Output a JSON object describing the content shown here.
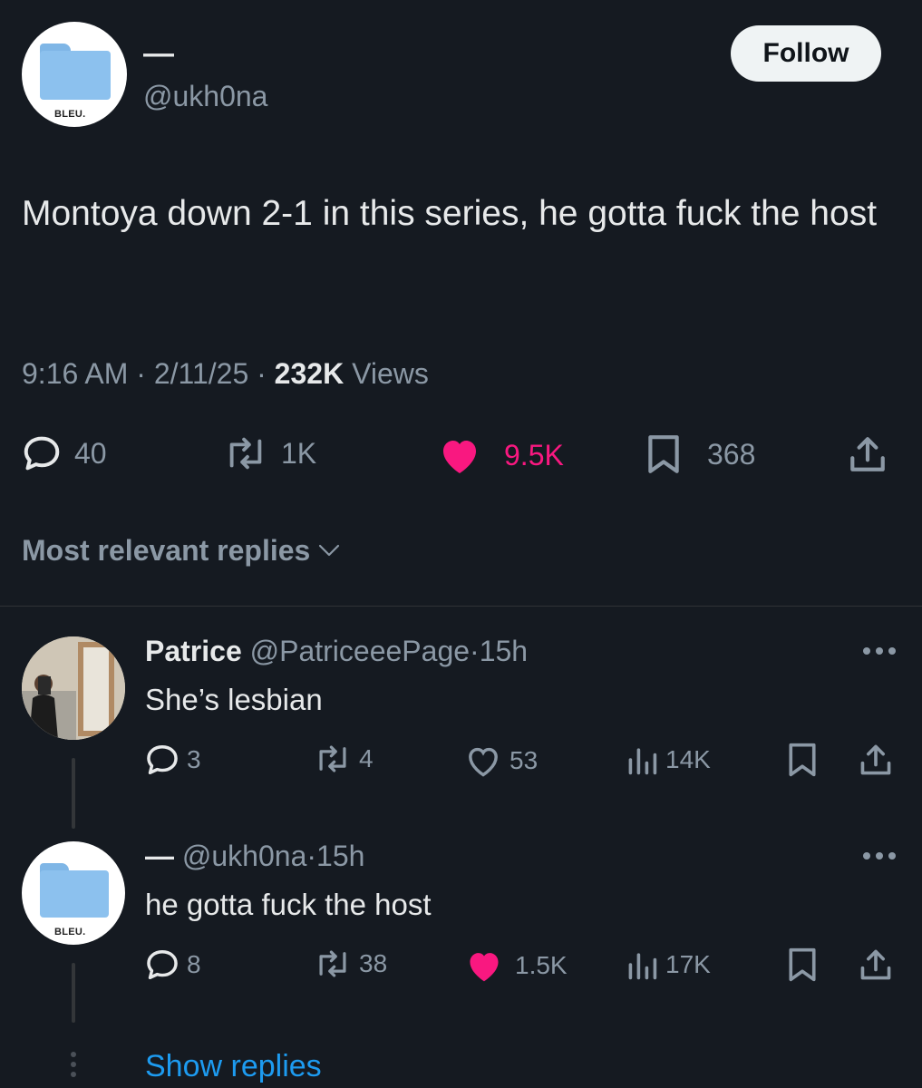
{
  "main_tweet": {
    "author_name": "—",
    "author_handle": "@ukh0na",
    "avatar_label": "BLEU.",
    "follow_label": "Follow",
    "text": "Montoya down 2-1 in this series, he gotta fuck the host",
    "time": "9:16 AM",
    "date": "2/11/25",
    "views_count": "232K",
    "views_label": "Views",
    "separator": "·",
    "actions": {
      "replies": "40",
      "reposts": "1K",
      "likes": "9.5K",
      "bookmarks": "368"
    },
    "liked": true
  },
  "sort": {
    "label": "Most relevant replies"
  },
  "replies": [
    {
      "name": "Patrice",
      "handle": "@PatriceeePage",
      "separator": "·",
      "age": "15h",
      "text": "She’s lesbian",
      "actions": {
        "replies": "3",
        "reposts": "4",
        "likes": "53",
        "views": "14K"
      },
      "liked": false
    },
    {
      "name": "—",
      "handle": "@ukh0na",
      "separator": "·",
      "age": "15h",
      "avatar_label": "BLEU.",
      "text": "he gotta fuck the host",
      "actions": {
        "replies": "8",
        "reposts": "38",
        "likes": "1.5K",
        "views": "17K"
      },
      "liked": true
    }
  ],
  "show_replies_label": "Show replies",
  "colors": {
    "background": "#151a21",
    "text": "#e7e9ea",
    "muted": "#8b98a5",
    "like_pink": "#f91880",
    "link_blue": "#1d9bf0",
    "folder_blue": "#8cc1ee"
  }
}
